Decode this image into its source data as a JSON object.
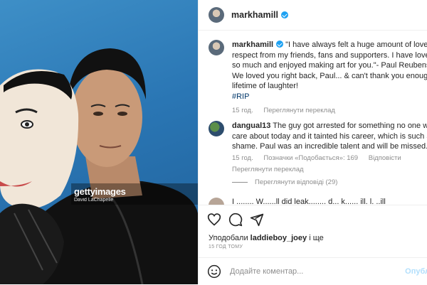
{
  "header": {
    "username": "markhamill"
  },
  "caption": {
    "username": "markhamill",
    "line1": "\"I have always felt a huge amount of love and",
    "line2": "respect from my friends, fans and supporters. I have loved you",
    "line3": "so much and enjoyed making art for you.\"- Paul Reubens",
    "line4": "We loved you right back, Paul... & can't thank you enough for",
    "line5": "lifetime of laughter!",
    "hashtag": "#RIP",
    "time": "15 год.",
    "translate": "Переглянути переклад"
  },
  "comment": {
    "username": "dangual13",
    "line1": "The guy got arrested for something no one would",
    "line2": "care about today and it tainted his career, which is such a",
    "line3": "shame. Paul was an incredible talent and will be missed.",
    "time": "15 год.",
    "likes": "Позначки «Подобається»: 169",
    "reply": "Відповісти",
    "translate": "Переглянути переклад",
    "view_replies": "Переглянути відповіді (29)"
  },
  "partial_comment": "I ........ W......ll did leak........ d... k...... ill. l. ..ill",
  "likes": {
    "prefix": "Уподобали",
    "user": "laddieboy_joey",
    "suffix": "і ще"
  },
  "timestamp": "15 ГОД ТОМУ",
  "composer": {
    "placeholder": "Додайте коментар...",
    "post_label": "Опубл"
  },
  "watermark": {
    "logo": "gettyimages",
    "credit": "David LaChapelle"
  },
  "colors": {
    "verified": "#1da1f2",
    "hashtag": "#00376b",
    "muted": "#8e8e8e",
    "photo_bg": "#2a76b4"
  },
  "icons": [
    "heart-icon",
    "comment-icon",
    "share-icon",
    "emoji-icon",
    "verified-icon"
  ]
}
